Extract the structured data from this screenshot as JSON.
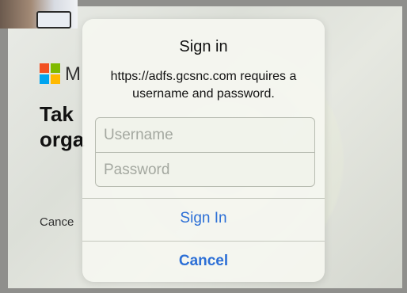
{
  "background": {
    "brand_partial": "M",
    "heading_partial": [
      "Tak",
      "orga"
    ],
    "cancel_partial": "Cance"
  },
  "dialog": {
    "title": "Sign in",
    "message": "https://adfs.gcsnc.com requires a username and password.",
    "username": {
      "placeholder": "Username",
      "value": ""
    },
    "password": {
      "placeholder": "Password",
      "value": ""
    },
    "sign_in_label": "Sign In",
    "cancel_label": "Cancel"
  },
  "colors": {
    "accent": "#2c6fd6",
    "ms_red": "#f25022",
    "ms_green": "#7fba00",
    "ms_blue": "#00a4ef",
    "ms_yellow": "#ffb900"
  }
}
